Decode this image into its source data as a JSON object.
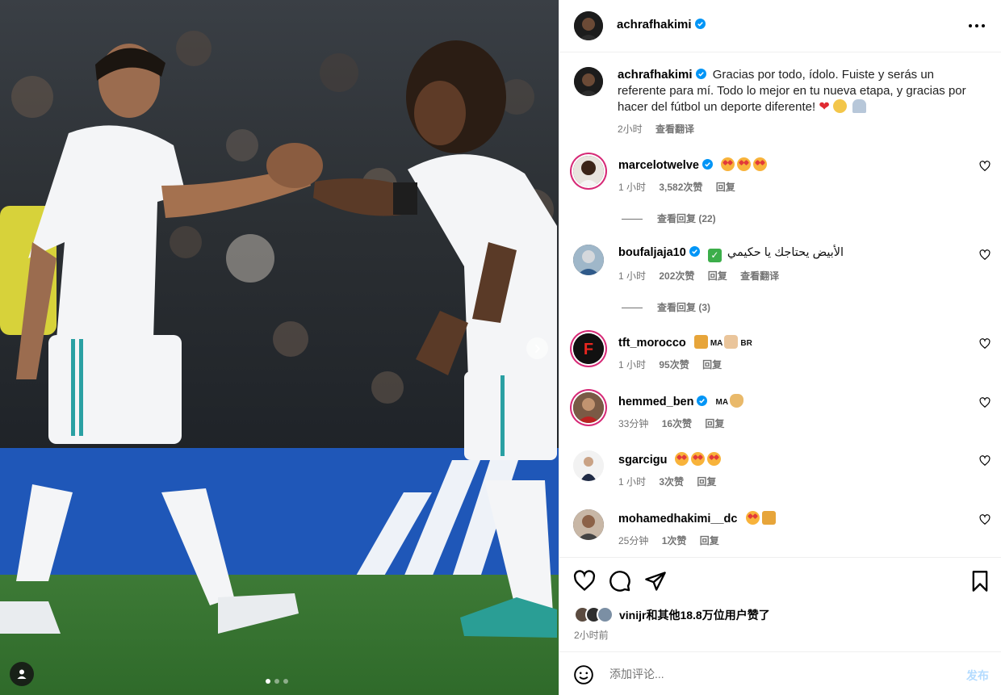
{
  "post": {
    "author": "achrafhakimi",
    "caption": "Gracias por todo, ídolo. Fuiste y serás un referente para mí. Todo lo mejor en tu nueva etapa, y gracias por hacer del fútbol un deporte diferente!",
    "caption_emoji": [
      "red-heart",
      "pleading-face",
      "folded-hands"
    ],
    "time": "2小时",
    "translate_label": "查看翻译",
    "image_count": 3,
    "active_image": 1
  },
  "comments": [
    {
      "user": "marcelotwelve",
      "verified": true,
      "text": "",
      "emoji": [
        "star-struck",
        "star-struck",
        "star-struck"
      ],
      "time": "1 小时",
      "likes": "3,582次赞",
      "reply": "回复",
      "view_replies": "查看回复 (22)"
    },
    {
      "user": "boufaljaja10",
      "verified": true,
      "text": "الأبيض يحتاجك يا حكيمي",
      "emoji": [
        "check-mark"
      ],
      "time": "1 小时",
      "likes": "202次赞",
      "reply": "回复",
      "translate": "查看翻译",
      "view_replies": "查看回复 (3)"
    },
    {
      "user": "tft_morocco",
      "verified": false,
      "text_a": "MA",
      "text_b": "BR",
      "emoji": [
        "lion",
        "handshake"
      ],
      "time": "1 小时",
      "likes": "95次赞",
      "reply": "回复"
    },
    {
      "user": "hemmed_ben",
      "verified": true,
      "text_a": "MA",
      "emoji": [
        "ok-hand"
      ],
      "time": "33分钟",
      "likes": "16次赞",
      "reply": "回复"
    },
    {
      "user": "sgarcigu",
      "verified": false,
      "emoji": [
        "star-struck",
        "star-struck",
        "star-struck"
      ],
      "time": "1 小时",
      "likes": "3次赞",
      "reply": "回复"
    },
    {
      "user": "mohamedhakimi__dc",
      "verified": false,
      "emoji": [
        "star-struck",
        "lion"
      ],
      "time": "25分钟",
      "likes": "1次赞",
      "reply": "回复"
    }
  ],
  "actions": {
    "liked_by": "vinijr和其他18.8万位用户赞了",
    "time": "2小时前"
  },
  "add_comment": {
    "placeholder": "添加评论...",
    "post_label": "发布"
  },
  "colors": {
    "verified_blue": "#0095f6",
    "muted_text": "#737373",
    "post_disabled": "#b3dbff"
  }
}
